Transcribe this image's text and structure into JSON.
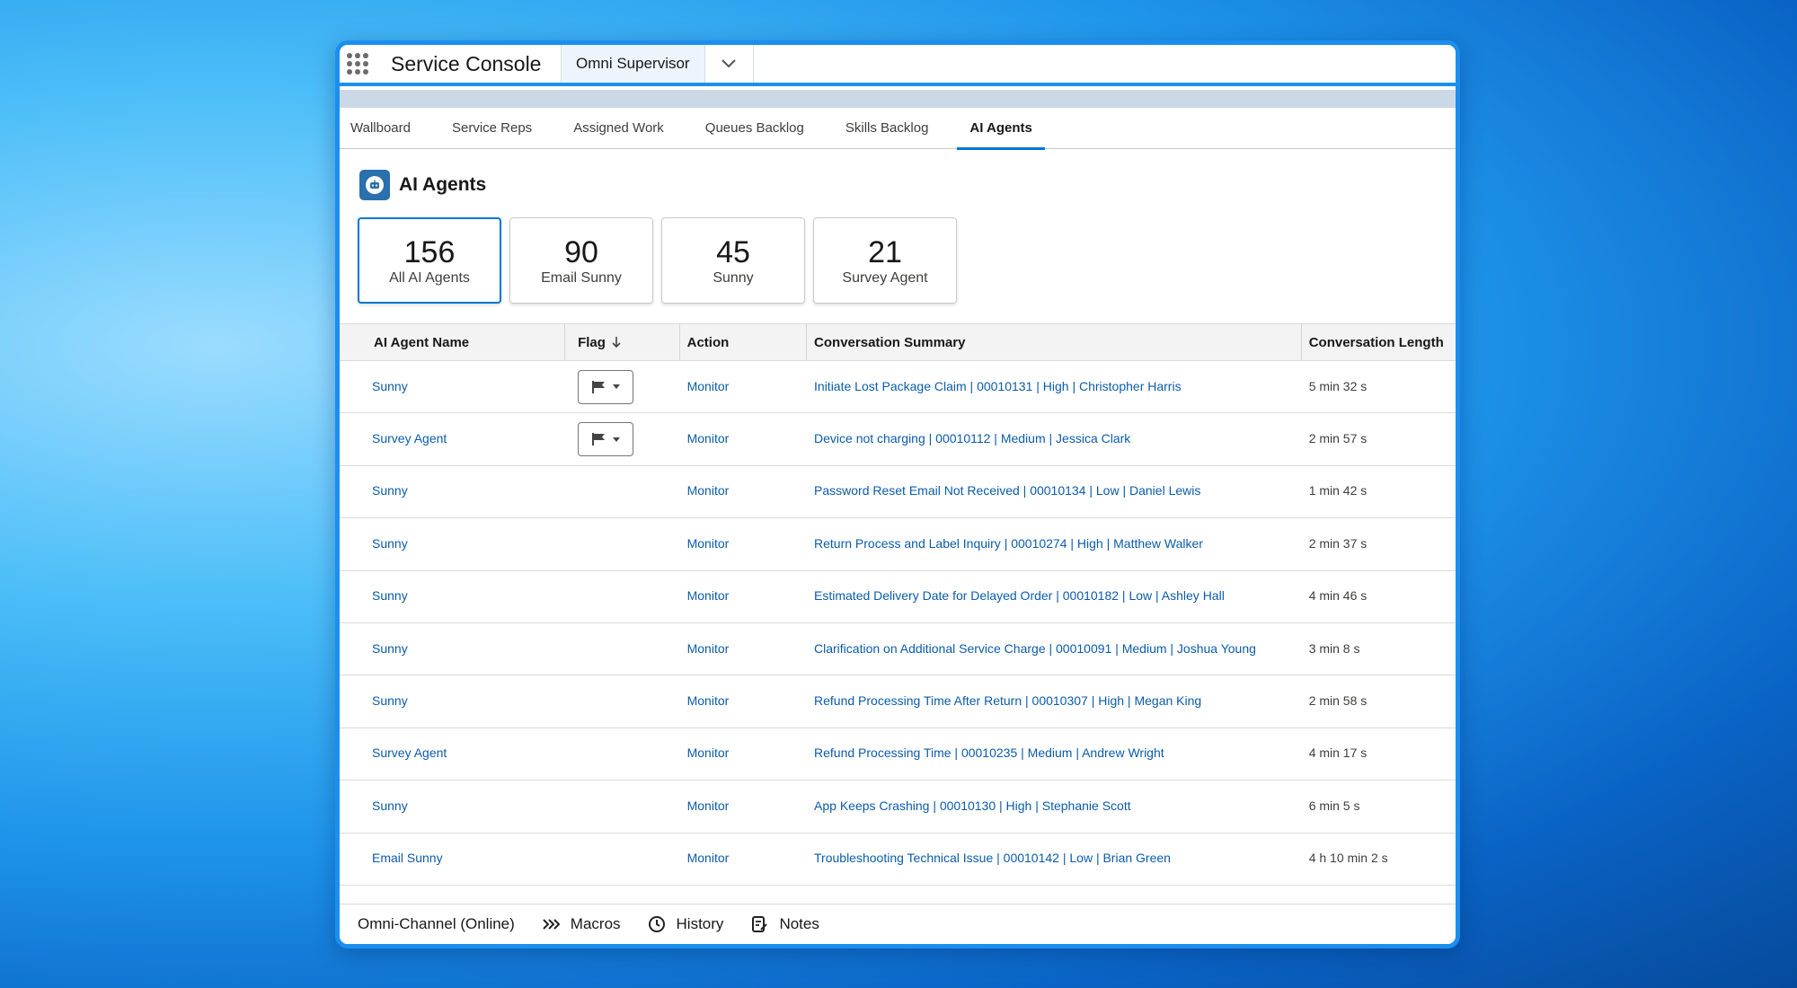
{
  "app": {
    "title": "Service Console",
    "nav_tab": "Omni Supervisor"
  },
  "subtabs": [
    "Wallboard",
    "Service Reps",
    "Assigned Work",
    "Queues Backlog",
    "Skills Backlog",
    "AI Agents"
  ],
  "active_subtab": "AI Agents",
  "page": {
    "title": "AI Agents"
  },
  "cards": [
    {
      "value": "156",
      "label": "All AI Agents"
    },
    {
      "value": "90",
      "label": "Email Sunny"
    },
    {
      "value": "45",
      "label": "Sunny"
    },
    {
      "value": "21",
      "label": "Survey Agent"
    }
  ],
  "table": {
    "headers": [
      "AI Agent Name",
      "Flag",
      "Action",
      "Conversation Summary",
      "Conversation Length"
    ],
    "rows": [
      {
        "agent": "Sunny",
        "flag": true,
        "action": "Monitor",
        "summary": "Initiate Lost Package Claim | 00010131 | High | Christopher Harris",
        "length": "5 min 32 s"
      },
      {
        "agent": "Survey Agent",
        "flag": true,
        "action": "Monitor",
        "summary": "Device not charging | 00010112 | Medium | Jessica Clark",
        "length": "2 min 57 s"
      },
      {
        "agent": "Sunny",
        "flag": false,
        "action": "Monitor",
        "summary": "Password Reset Email Not Received | 00010134 | Low | Daniel Lewis",
        "length": "1 min 42 s"
      },
      {
        "agent": "Sunny",
        "flag": false,
        "action": "Monitor",
        "summary": "Return Process and Label Inquiry | 00010274 | High | Matthew Walker",
        "length": "2 min 37 s"
      },
      {
        "agent": "Sunny",
        "flag": false,
        "action": "Monitor",
        "summary": "Estimated Delivery Date for Delayed Order | 00010182 | Low | Ashley Hall",
        "length": "4 min 46 s"
      },
      {
        "agent": "Sunny",
        "flag": false,
        "action": "Monitor",
        "summary": "Clarification on Additional Service Charge | 00010091 | Medium | Joshua Young",
        "length": "3 min 8 s"
      },
      {
        "agent": "Sunny",
        "flag": false,
        "action": "Monitor",
        "summary": "Refund Processing Time After Return | 00010307 | High | Megan King",
        "length": "2 min 58 s"
      },
      {
        "agent": "Survey Agent",
        "flag": false,
        "action": "Monitor",
        "summary": "Refund Processing Time | 00010235 | Medium | Andrew Wright",
        "length": "4 min 17 s"
      },
      {
        "agent": "Sunny",
        "flag": false,
        "action": "Monitor",
        "summary": "App Keeps Crashing | 00010130 | High | Stephanie Scott",
        "length": "6 min 5 s"
      },
      {
        "agent": "Email Sunny",
        "flag": false,
        "action": "Monitor",
        "summary": "Troubleshooting Technical Issue | 00010142 | Low | Brian Green",
        "length": "4 h 10 min 2 s"
      }
    ]
  },
  "footer": {
    "items": [
      {
        "label": "Omni-Channel (Online)",
        "icon": "omni-channel-icon"
      },
      {
        "label": "Macros",
        "icon": "macros-icon"
      },
      {
        "label": "History",
        "icon": "clock-icon"
      },
      {
        "label": "Notes",
        "icon": "notes-icon"
      }
    ]
  },
  "colors": {
    "accent": "#0176d3",
    "link": "#0b5cab",
    "window_border": "#1b8ff0",
    "header_icon": "#2a6fae"
  }
}
